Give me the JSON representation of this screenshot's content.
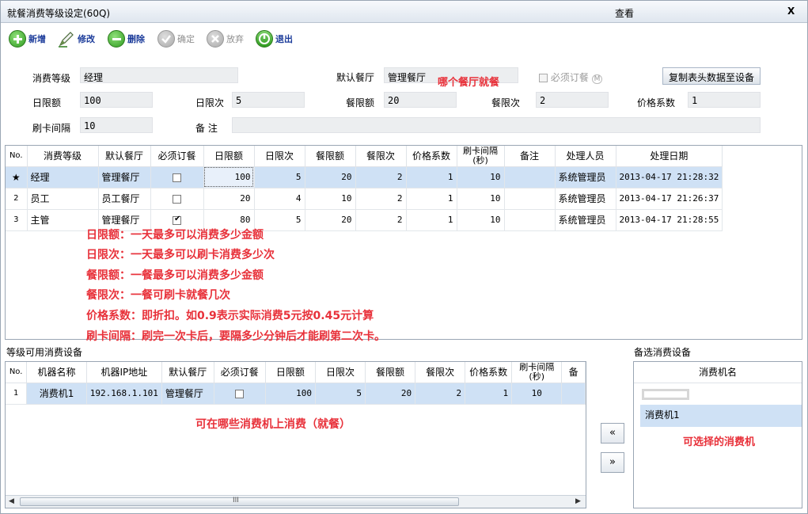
{
  "window": {
    "title": "就餐消费等级设定(60Q)",
    "mode": "查看",
    "close": "X"
  },
  "toolbar": {
    "new": "新增",
    "edit": "修改",
    "delete": "删除",
    "confirm": "确定",
    "cancel": "放弃",
    "exit": "退出"
  },
  "form": {
    "level_label": "消费等级",
    "level_value": "经理",
    "restaurant_label": "默认餐厅",
    "restaurant_value": "管理餐厅",
    "must_order_label": "必须订餐",
    "copy_button": "复制表头数据至设备",
    "day_amount_label": "日限额",
    "day_amount_value": "100",
    "day_times_label": "日限次",
    "day_times_value": "5",
    "meal_amount_label": "餐限额",
    "meal_amount_value": "20",
    "meal_times_label": "餐限次",
    "meal_times_value": "2",
    "price_factor_label": "价格系数",
    "price_factor_value": "1",
    "interval_label": "刷卡间隔",
    "interval_value": "10",
    "remark_label": "备  注",
    "remark_value": ""
  },
  "annotations": {
    "restaurant_note": "哪个餐厅就餐",
    "line1": "日限额：一天最多可以消费多少金额",
    "line2": "日限次：一天最多可以刷卡消费多少次",
    "line3": "餐限额：一餐最多可以消费多少金额",
    "line4": "餐限次：一餐可刷卡就餐几次",
    "line5": "价格系数：即折扣。如0.9表示实际消费5元按0.45元计算",
    "line6": "刷卡间隔：刷完一次卡后，要隔多少分钟后才能刷第二次卡。",
    "machines_note": "可在哪些消费机上消费（就餐）",
    "available_note": "可选择的消费机"
  },
  "levels_table": {
    "headers": [
      "No.",
      "消费等级",
      "默认餐厅",
      "必须订餐",
      "日限额",
      "日限次",
      "餐限额",
      "餐限次",
      "价格系数",
      "刷卡间隔(秒)",
      "备注",
      "处理人员",
      "处理日期"
    ],
    "rows": [
      {
        "no": "★",
        "level": "经理",
        "restaurant": "管理餐厅",
        "must": false,
        "day_amount": "100",
        "day_times": "5",
        "meal_amount": "20",
        "meal_times": "2",
        "factor": "1",
        "interval": "10",
        "remark": "",
        "operator": "系统管理员",
        "date": "2013-04-17 21:28:32"
      },
      {
        "no": "2",
        "level": "员工",
        "restaurant": "员工餐厅",
        "must": false,
        "day_amount": "20",
        "day_times": "4",
        "meal_amount": "10",
        "meal_times": "2",
        "factor": "1",
        "interval": "10",
        "remark": "",
        "operator": "系统管理员",
        "date": "2013-04-17 21:26:37"
      },
      {
        "no": "3",
        "level": "主管",
        "restaurant": "管理餐厅",
        "must": true,
        "day_amount": "80",
        "day_times": "5",
        "meal_amount": "20",
        "meal_times": "2",
        "factor": "1",
        "interval": "10",
        "remark": "",
        "operator": "系统管理员",
        "date": "2013-04-17 21:28:55"
      }
    ]
  },
  "devices_section": {
    "title": "等级可用消费设备",
    "headers": [
      "No.",
      "机器名称",
      "机器IP地址",
      "默认餐厅",
      "必须订餐",
      "日限额",
      "日限次",
      "餐限额",
      "餐限次",
      "价格系数",
      "刷卡间隔(秒)",
      "备"
    ],
    "rows": [
      {
        "no": "1",
        "name": "消费机1",
        "ip": "192.168.1.101",
        "restaurant": "管理餐厅",
        "must": false,
        "day_amount": "100",
        "day_times": "5",
        "meal_amount": "20",
        "meal_times": "2",
        "factor": "1",
        "interval": "10"
      }
    ],
    "scroll_mark": "III"
  },
  "available_section": {
    "title": "备选消费设备",
    "header": "消费机名",
    "items": [
      "消费机1"
    ]
  },
  "move_buttons": {
    "left": "«",
    "right": "»"
  }
}
